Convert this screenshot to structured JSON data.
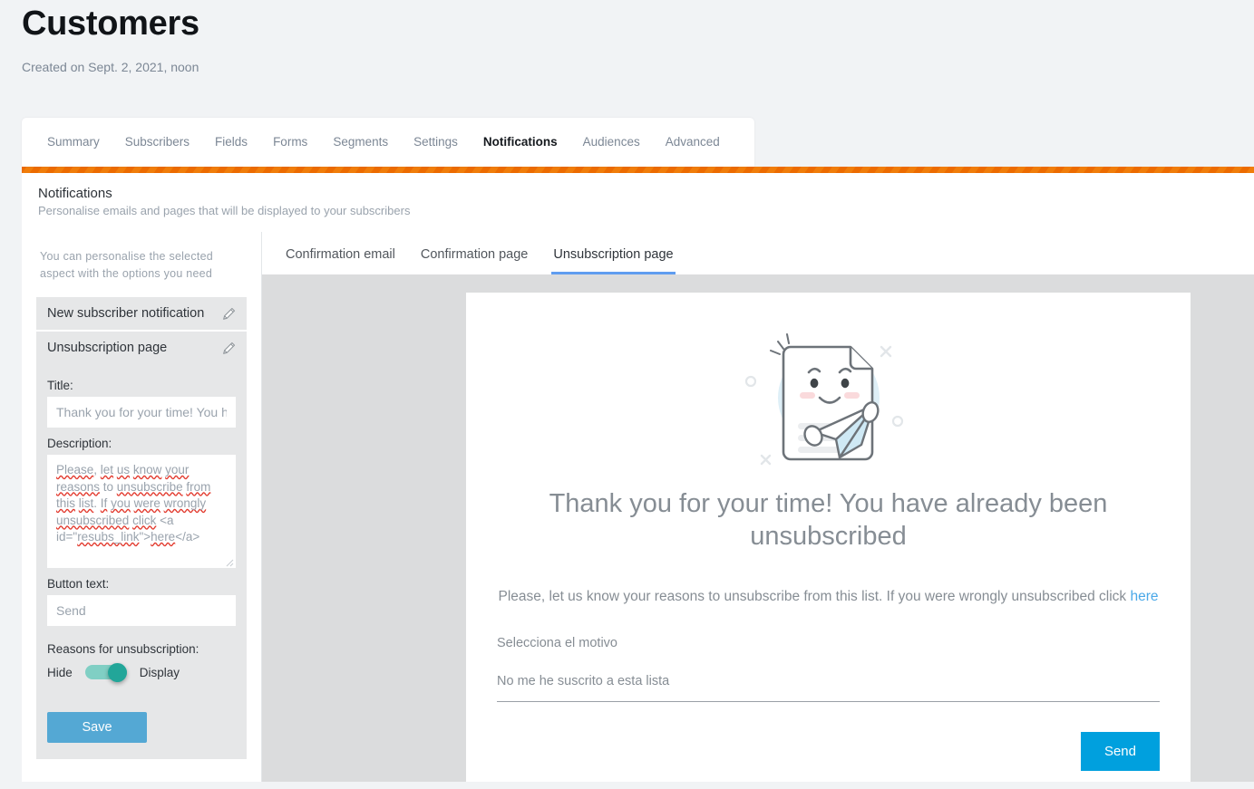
{
  "header": {
    "title": "Customers",
    "created": "Created on Sept. 2, 2021, noon"
  },
  "main_tabs": [
    {
      "label": "Summary",
      "active": false
    },
    {
      "label": "Subscribers",
      "active": false
    },
    {
      "label": "Fields",
      "active": false
    },
    {
      "label": "Forms",
      "active": false
    },
    {
      "label": "Segments",
      "active": false
    },
    {
      "label": "Settings",
      "active": false
    },
    {
      "label": "Notifications",
      "active": true
    },
    {
      "label": "Audiences",
      "active": false
    },
    {
      "label": "Advanced",
      "active": false
    }
  ],
  "section": {
    "title": "Notifications",
    "subtitle": "Personalise emails and pages that will be displayed to your subscribers"
  },
  "options": {
    "hint": "You can personalise the selected aspect with the options you need",
    "accordion": [
      {
        "label": "New subscriber notification",
        "icon": "pencil-icon",
        "open": false
      },
      {
        "label": "Unsubscription page",
        "icon": "pencil-icon",
        "open": true
      }
    ],
    "title_field": {
      "label": "Title:",
      "value": "",
      "placeholder": "Thank you for your time! You have already been unsubscribed"
    },
    "description_field": {
      "label": "Description:",
      "value": "",
      "placeholder": "Please, let us know your reasons to unsubscribe from this list. If you were wrongly unsubscribed click <a id=\"resubs_link\">here</a>",
      "misspelled_words": [
        "Please",
        "let",
        "us",
        "know",
        "your",
        "reasons",
        "unsubscribe",
        "from",
        "this",
        "list",
        "If",
        "you",
        "were",
        "wrongly",
        "unsubscribed",
        "resubs_link",
        "here"
      ]
    },
    "button_text_field": {
      "label": "Button text:",
      "value": "",
      "placeholder": "Send"
    },
    "reasons_toggle": {
      "label": "Reasons for unsubscription:",
      "off_label": "Hide",
      "on_label": "Display",
      "state": "on",
      "track_color": "#80cfc4",
      "knob_color": "#22a699"
    },
    "save_button": "Save"
  },
  "preview_tabs": [
    {
      "label": "Confirmation email",
      "active": false
    },
    {
      "label": "Confirmation page",
      "active": false
    },
    {
      "label": "Unsubscription page",
      "active": true
    }
  ],
  "preview": {
    "illustration": "document-with-paper-plane-illustration",
    "heading": "Thank you for your time! You have already been unsubscribed",
    "body_text": "Please, let us know your reasons to unsubscribe from this list. If you were wrongly unsubscribed click ",
    "body_link": "here",
    "reason_label": "Selecciona el motivo",
    "reason_selected": "No me he suscrito a esta lista",
    "send_button": "Send"
  },
  "colors": {
    "accent_orange": "#ec6b00",
    "send_blue": "#00a0de",
    "save_blue": "#54a8d4",
    "active_tab_underline": "#5f9df0",
    "toggle_teal": "#22a699",
    "stage_gray": "#dbdcdd"
  }
}
